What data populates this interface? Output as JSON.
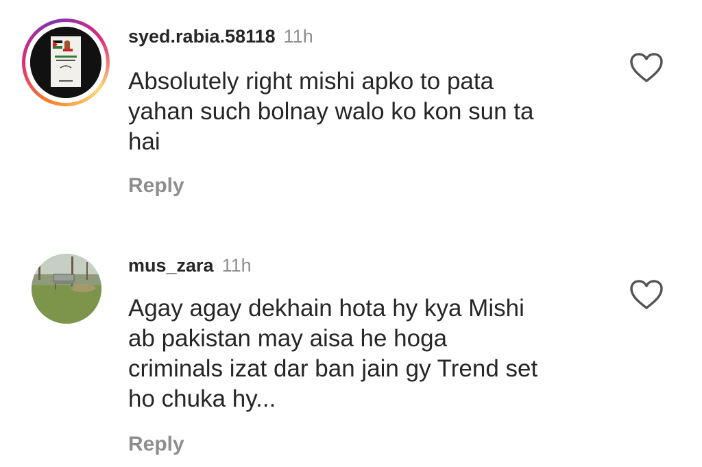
{
  "comments": [
    {
      "username": "syed.rabia.58118",
      "time": "11h",
      "text_lines": [
        "Absolutely right mishi apko to pata",
        "yahan such bolnay walo ko kon sun ta",
        "hai"
      ],
      "reply_label": "Reply",
      "avatar": "story-ring-avatar",
      "like_icon": "heart-outline-icon"
    },
    {
      "username": "mus_zara",
      "time": "11h",
      "text_lines": [
        "Agay agay dekhain hota hy kya Mishi",
        "ab pakistan may aisa he hoga",
        "criminals izat dar ban jain gy Trend set",
        "ho chuka hy..."
      ],
      "reply_label": "Reply",
      "avatar": "park-bench-avatar",
      "like_icon": "heart-outline-icon"
    }
  ],
  "colors": {
    "text": "#262626",
    "muted": "#8e8e8e",
    "background": "#ffffff"
  }
}
